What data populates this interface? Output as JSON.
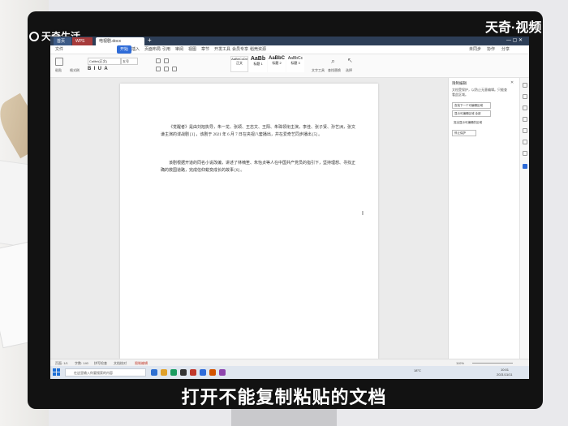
{
  "watermark": {
    "left": "天奇生活",
    "right": "天奇·视频"
  },
  "subtitle": "打开不能复制粘贴的文档",
  "titlebar": {
    "tabs": [
      "首页",
      "WPS",
      "电视剧.docx"
    ],
    "new_tab": "+"
  },
  "menu": {
    "items": [
      "文件",
      "开始",
      "插入",
      "页面布局",
      "引用",
      "审阅",
      "视图",
      "章节",
      "开发工具",
      "会员专享",
      "稻壳资源"
    ],
    "active": "开始",
    "right": [
      "未同步",
      "协作",
      "分享"
    ]
  },
  "ribbon": {
    "font_name": "Calibri(正文)",
    "font_size": "五号",
    "paste": "粘贴",
    "format_painter": "格式刷",
    "styles": [
      {
        "preview": "AaBbCcDd",
        "name": "正文"
      },
      {
        "preview": "AaBb",
        "name": "标题 1"
      },
      {
        "preview": "AaBbC",
        "name": "标题 2"
      },
      {
        "preview": "AaBbCc",
        "name": "标题 3"
      }
    ],
    "text_tools": "文字工具",
    "find_replace": "查找替换",
    "select": "选择"
  },
  "document": {
    "para1": "《觉醒者》是由刘旭执导，朱一龙、张颂、王志文、王阳、朱珠领衔主演，李佳、张子贤、孙艺洲，张文谦主演的谍战剧 [1] ，该剧于 2021 年 6 月 7 日在央视八套播出，并在爱奇艺同步播出 [5] 。",
    "para2": "该剧根据开道的同名小说改编，讲述了林楠笙、朱怡贞等人在中国共产党员的指引下，坚持理想、寻找正确的救国道路，完成信仰蜕变成长的故事 [6] 。"
  },
  "pane": {
    "title": "限制编辑",
    "desc": "文档受保护，以防止无意编辑。只能查看此区域。",
    "buttons": [
      "查找下一个可编辑区域",
      "显示可编辑区域 全部",
      "突出显示可编辑的区域",
      "停止保护"
    ]
  },
  "status": {
    "page": "页面: 1/1",
    "words": "字数: 140",
    "spell": "拼写检查",
    "compat": "文档校对",
    "protect": "限制编辑",
    "zoom": "110%"
  },
  "taskbar": {
    "search_placeholder": "在这里输入你要搜索的内容",
    "weather": "18°C",
    "time": "10:01",
    "date": "2021/11/11"
  }
}
